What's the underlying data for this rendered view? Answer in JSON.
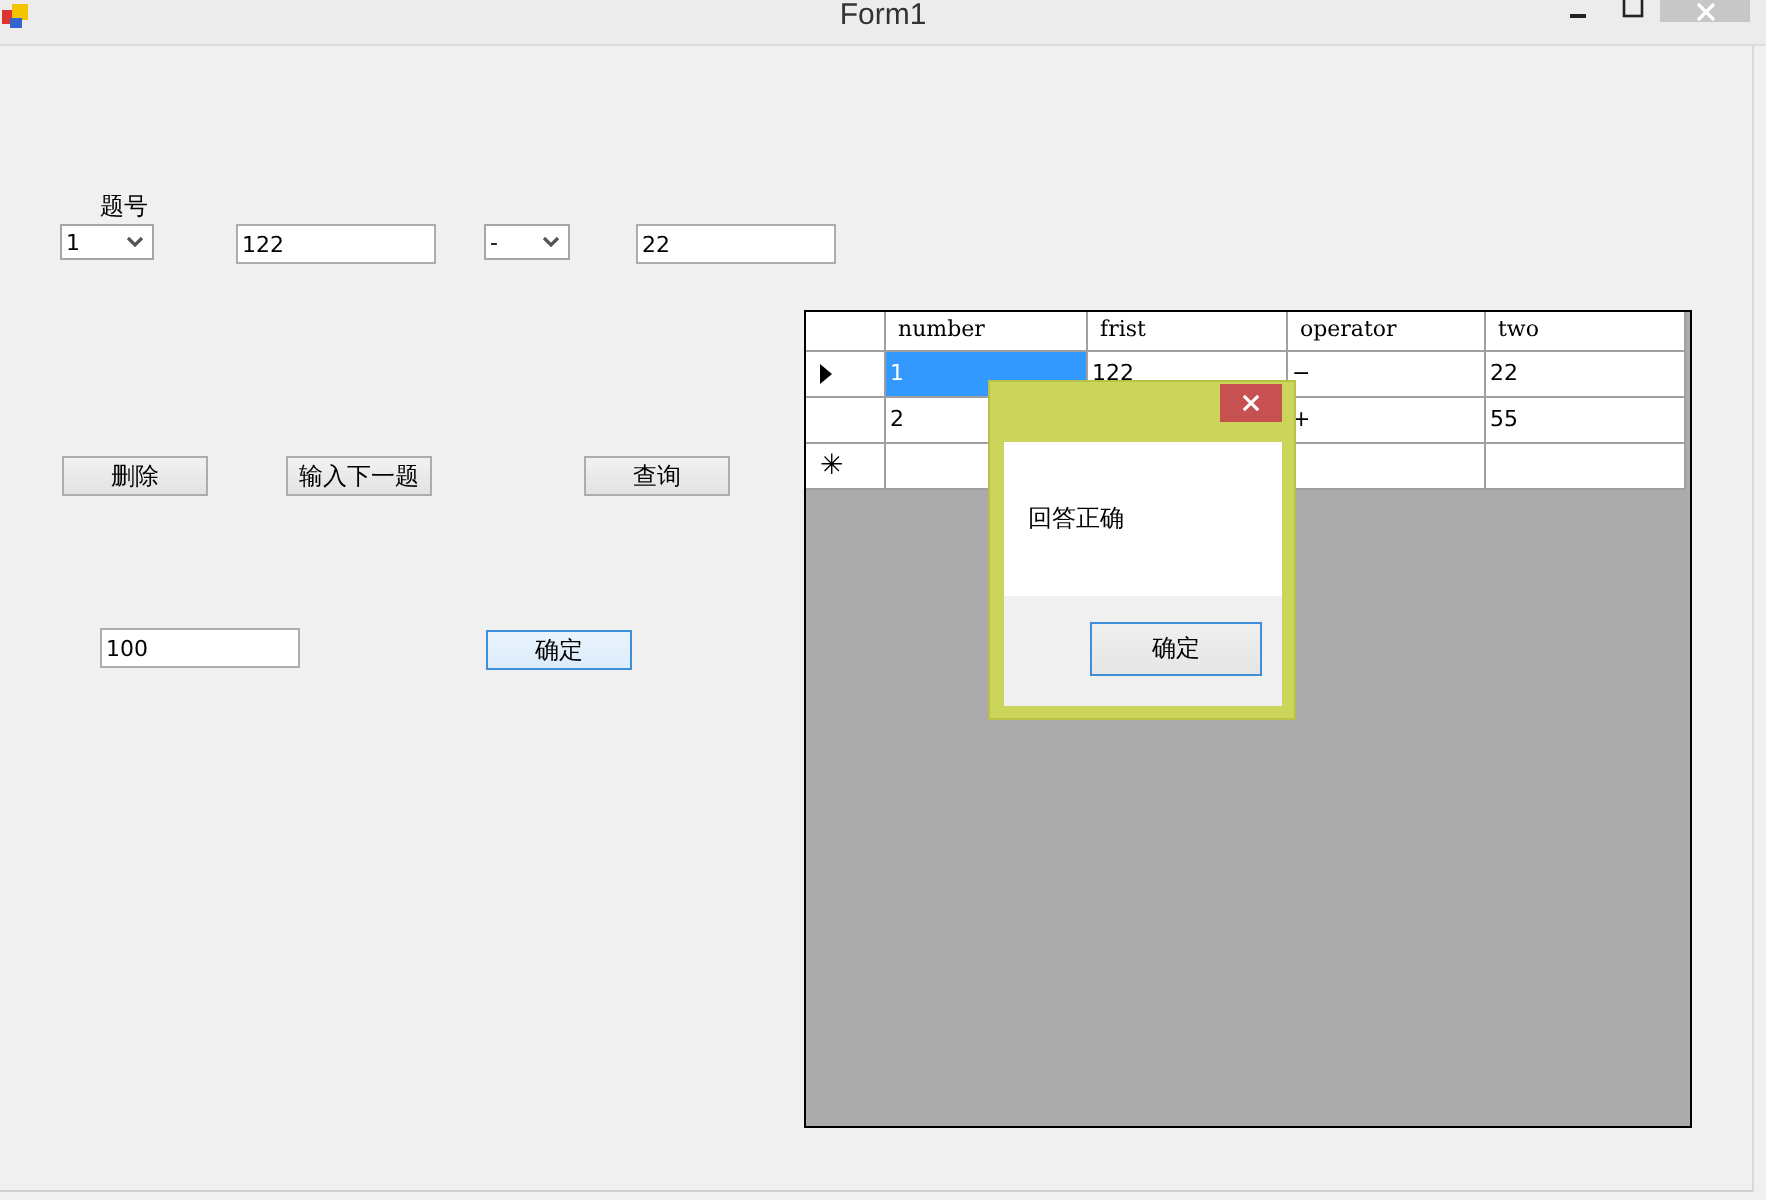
{
  "window": {
    "title": "Form1"
  },
  "form": {
    "question_label": "题号",
    "question_combo": {
      "value": "1"
    },
    "first_field": {
      "value": "122"
    },
    "operator_combo": {
      "value": "-"
    },
    "second_field": {
      "value": "22"
    },
    "buttons": [
      {
        "label": "删除",
        "focused": false
      },
      {
        "label": "输入下一题",
        "focused": false
      },
      {
        "label": "查询",
        "focused": false
      }
    ],
    "answer_field": {
      "value": "100"
    },
    "confirm_button": {
      "label": "确定",
      "focused": true
    }
  },
  "grid": {
    "columns": [
      "number",
      "frist",
      "operator",
      "two"
    ],
    "rows": [
      {
        "kind": "data",
        "current": true,
        "cells": [
          {
            "text": "1",
            "selected": true
          },
          {
            "text": "122",
            "selected": false
          },
          {
            "text": "−",
            "selected": false
          },
          {
            "text": "22",
            "selected": false
          }
        ]
      },
      {
        "kind": "data",
        "current": false,
        "cells": [
          {
            "text": "2",
            "selected": false
          },
          {},
          {
            "text": "+",
            "selected": false
          },
          {
            "text": "55",
            "selected": false
          }
        ]
      },
      {
        "kind": "new",
        "marker": "✳"
      }
    ]
  },
  "dialog": {
    "message": "回答正确",
    "button": "确定"
  }
}
